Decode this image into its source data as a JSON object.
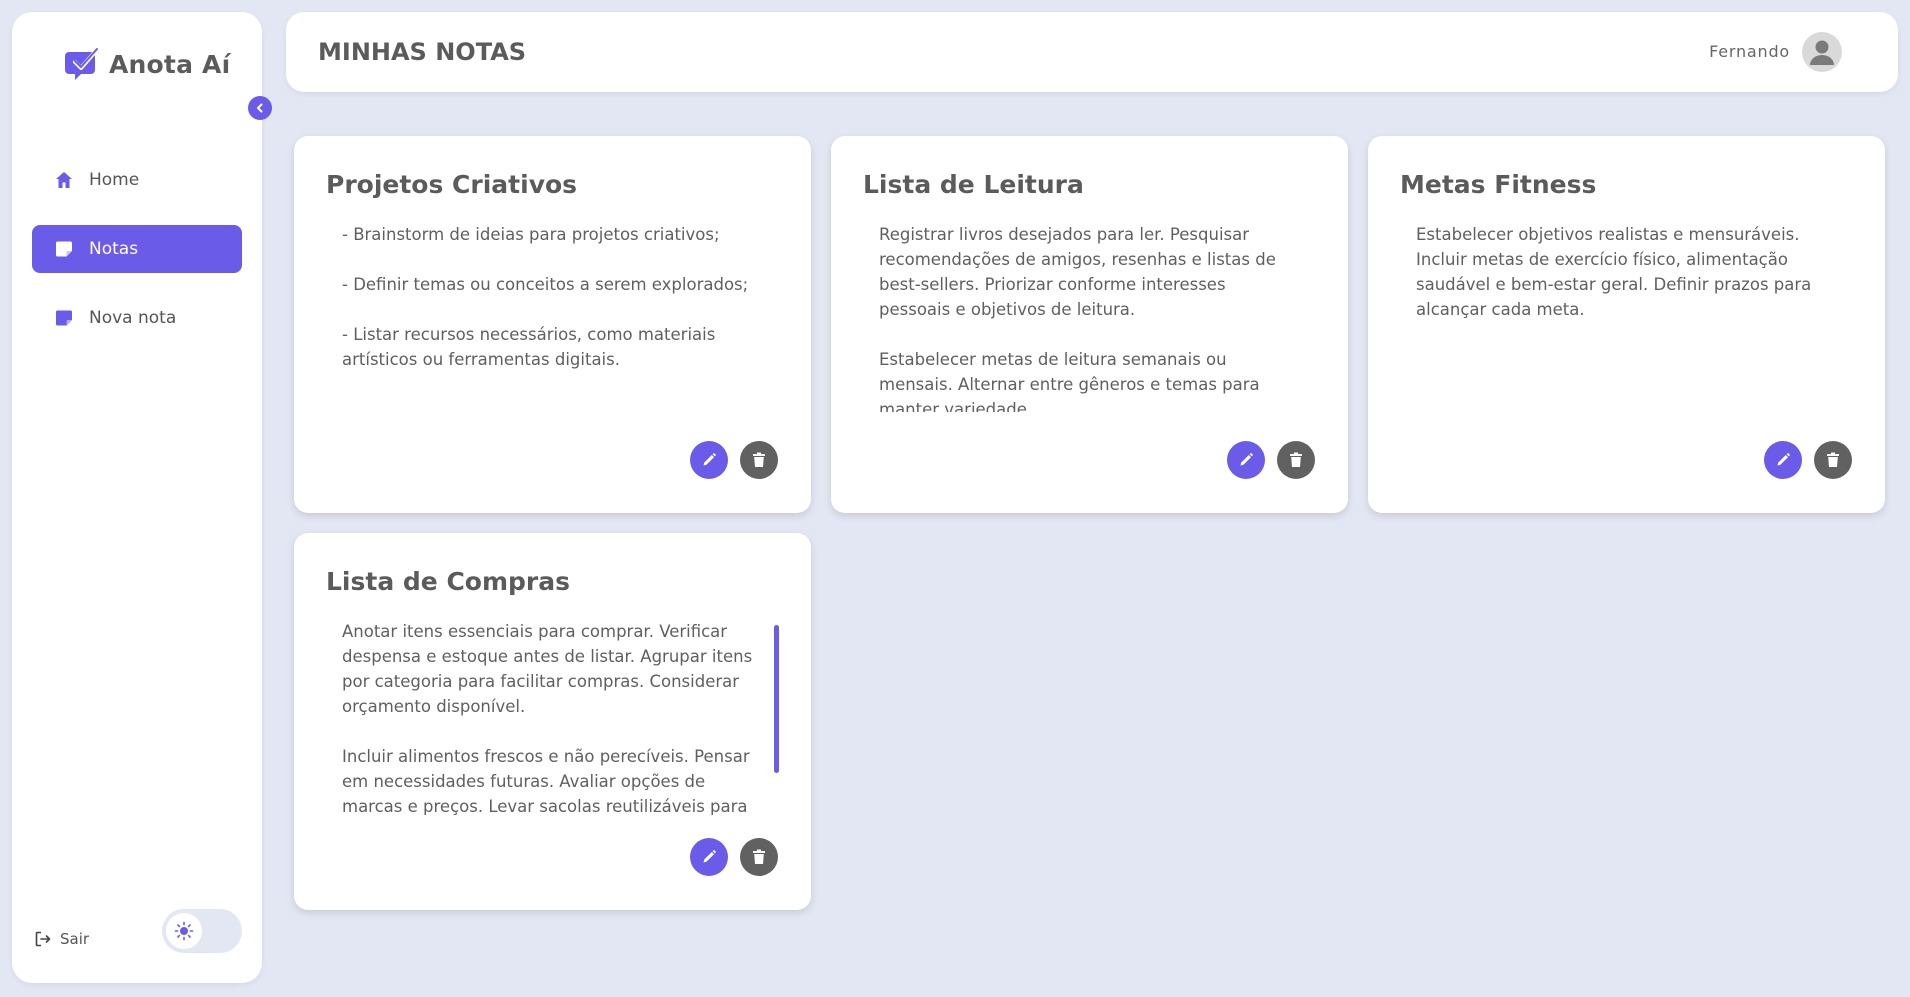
{
  "app": {
    "name": "Anota Aí",
    "accent": "#6a5be8"
  },
  "sidebar": {
    "items": [
      {
        "label": "Home",
        "icon": "home-icon",
        "active": false
      },
      {
        "label": "Notas",
        "icon": "note-icon",
        "active": true
      },
      {
        "label": "Nova nota",
        "icon": "note-add-icon",
        "active": false
      }
    ],
    "logout_label": "Sair",
    "theme": "light"
  },
  "header": {
    "title": "MINHAS NOTAS",
    "user": "Fernando"
  },
  "notes": [
    {
      "title": "Projetos Criativos",
      "paragraphs": [
        "- Brainstorm de ideias para projetos criativos;",
        "- Definir temas ou conceitos a serem explorados;",
        "- Listar recursos necessários, como materiais artísticos ou ferramentas digitais."
      ]
    },
    {
      "title": "Lista de Leitura",
      "paragraphs": [
        "Registrar livros desejados para ler. Pesquisar recomendações de amigos, resenhas e listas de best-sellers. Priorizar conforme interesses pessoais e objetivos de leitura.",
        "Estabelecer metas de leitura semanais ou mensais. Alternar entre gêneros e temas para manter variedade."
      ]
    },
    {
      "title": "Metas Fitness",
      "paragraphs": [
        "Estabelecer objetivos realistas e mensuráveis. Incluir metas de exercício físico, alimentação saudável e bem-estar geral. Definir prazos para alcançar cada meta."
      ]
    },
    {
      "title": "Lista de Compras",
      "paragraphs": [
        "Anotar itens essenciais para comprar. Verificar despensa e estoque antes de listar. Agrupar itens por categoria para facilitar compras. Considerar orçamento disponível.",
        "Incluir alimentos frescos e não perecíveis. Pensar em necessidades futuras. Avaliar opções de marcas e preços. Levar sacolas reutilizáveis para"
      ]
    }
  ]
}
